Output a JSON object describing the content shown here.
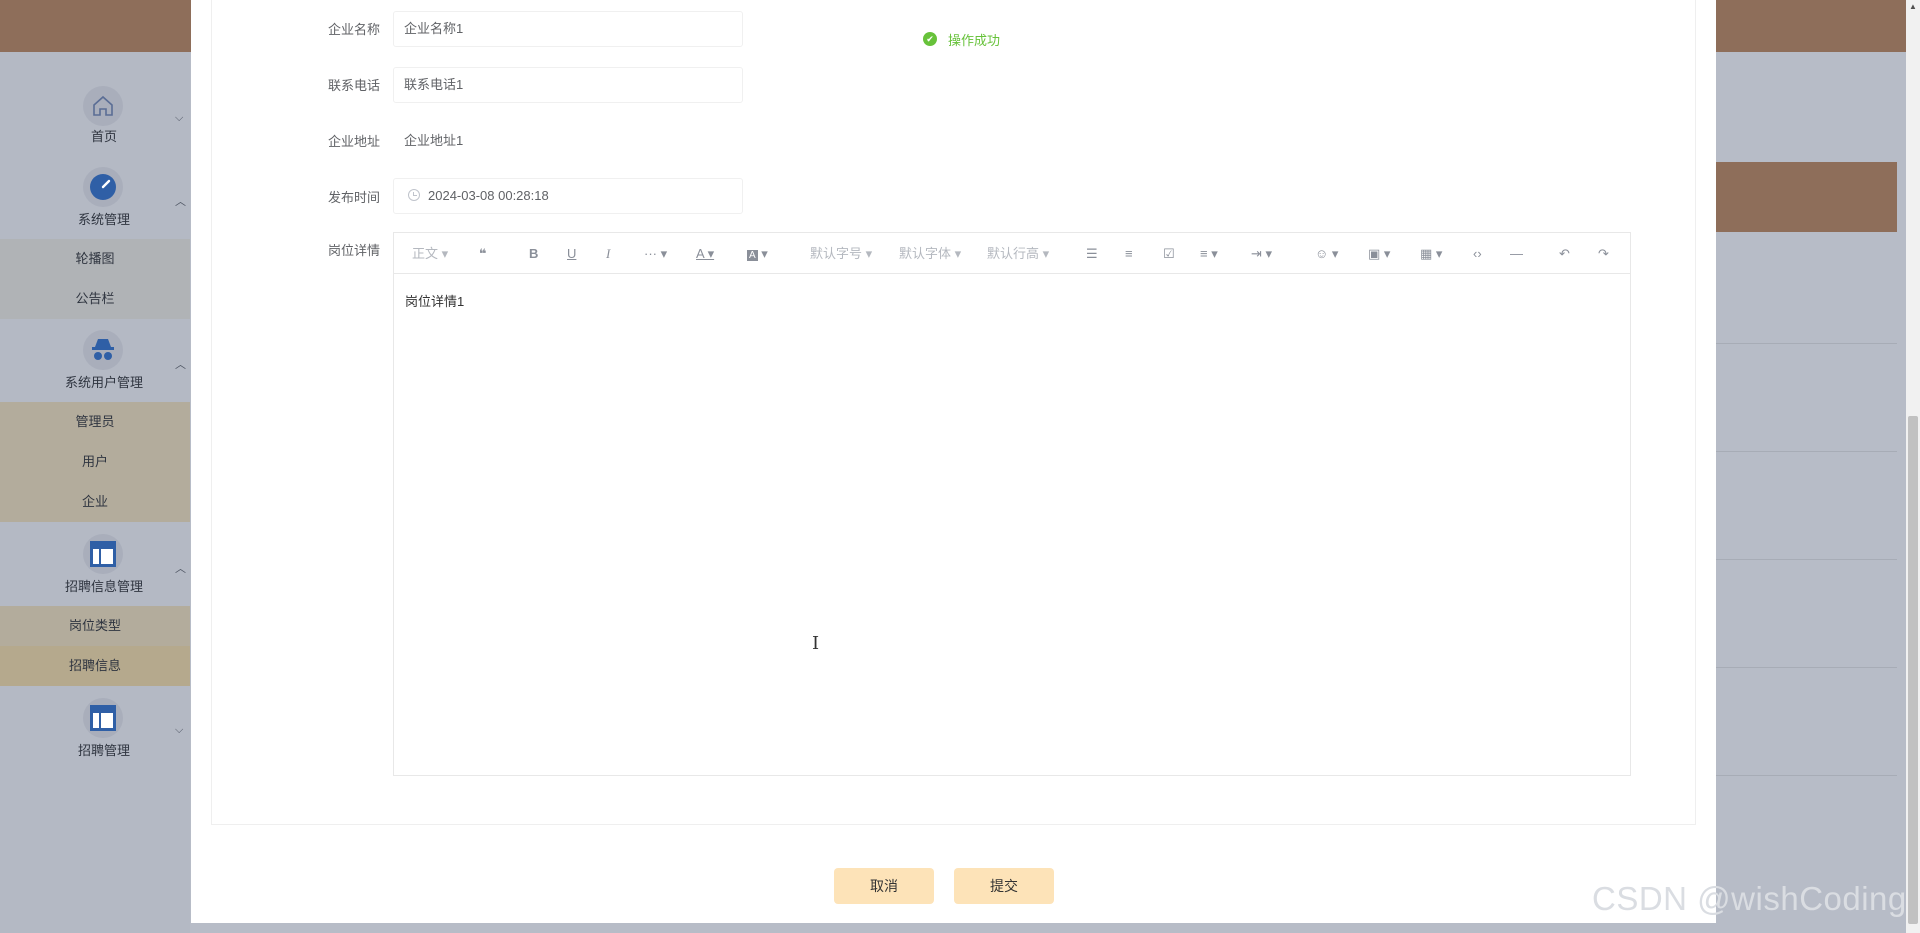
{
  "sidebar": {
    "home": "首页",
    "system_mgmt": "系统管理",
    "carousel": "轮播图",
    "notice": "公告栏",
    "user_mgmt": "系统用户管理",
    "admin": "管理员",
    "user": "用户",
    "company": "企业",
    "recruit_info_mgmt": "招聘信息管理",
    "job_type": "岗位类型",
    "recruit_info": "招聘信息",
    "recruit_mgmt": "招聘管理"
  },
  "form": {
    "company_name_label": "企业名称",
    "company_name_value": "企业名称1",
    "phone_label": "联系电话",
    "phone_value": "联系电话1",
    "address_label": "企业地址",
    "address_value": "企业地址1",
    "publish_time_label": "发布时间",
    "publish_time_value": "2024-03-08 00:28:18",
    "job_detail_label": "岗位详情",
    "job_detail_value": "岗位详情1"
  },
  "editor_toolbar": {
    "paragraph": "正文",
    "quote": "❝",
    "bold": "B",
    "underline": "U",
    "italic": "I",
    "more": "···",
    "font_color": "A",
    "bg_color": "A",
    "font_size": "默认字号",
    "font_family": "默认字体",
    "line_height": "默认行高",
    "bullet_list": "☰",
    "numbered_list": "≡",
    "todo": "☑",
    "align": "≡",
    "indent": "⇥",
    "emoji": "☺",
    "image": "▣",
    "table": "▦",
    "code": "‹›",
    "divider": "―",
    "undo": "↶",
    "redo": "↷"
  },
  "toast": {
    "message": "操作成功"
  },
  "buttons": {
    "cancel": "取消",
    "submit": "提交"
  },
  "watermark": "CSDN @wishCoding",
  "colors": {
    "accent": "#8e6e5a",
    "success": "#67c23a",
    "button_bg": "#fde3b8"
  }
}
